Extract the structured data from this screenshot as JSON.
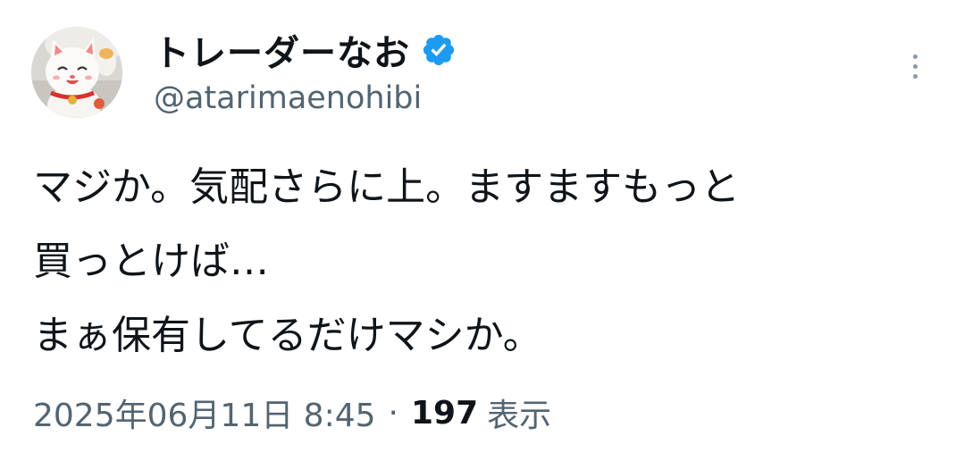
{
  "author": {
    "display_name": "トレーダーなお",
    "handle": "@atarimaenohibi",
    "verified_color": "#1d9bf0",
    "avatar": "maneki-neko-photo"
  },
  "tweet": {
    "lines": [
      "マジか。気配さらに上。ますますもっと",
      "買っとけば…",
      "まぁ保有してるだけマシか。"
    ]
  },
  "meta": {
    "timestamp": "2025年06月11日 8:45",
    "separator": "·",
    "views_count": "197",
    "views_label": "表示"
  },
  "icons": {
    "verified": "verified-badge-icon",
    "more": "more-vertical-icon"
  },
  "colors": {
    "text_primary": "#0f1419",
    "text_secondary": "#536471",
    "accent": "#1d9bf0"
  }
}
